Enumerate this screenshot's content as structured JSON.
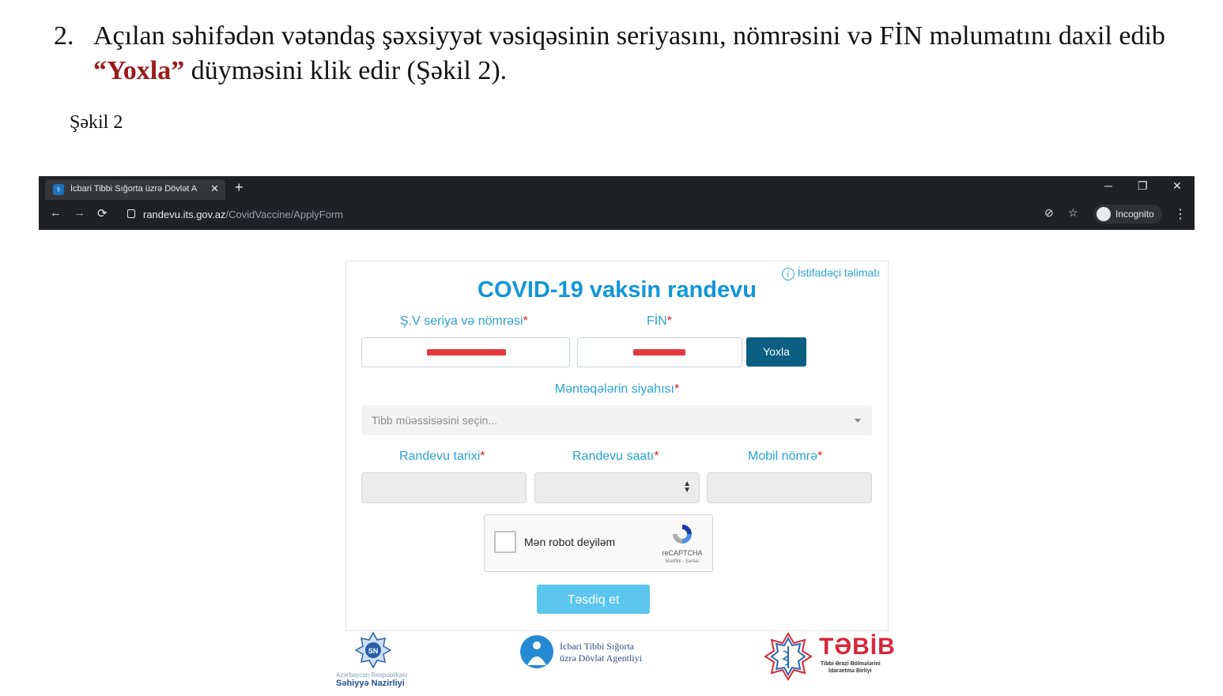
{
  "document": {
    "step_number": "2.",
    "step_before": "Açılan səhifədən vətəndaş şəxsiyyət vəsiqəsinin seriyasını, nömrəsini və FİN məlumatını daxil edib ",
    "step_highlight": "“Yoxla”",
    "step_after": " düyməsini klik edir (Şəkil 2).",
    "caption": "Şəkil 2"
  },
  "browser": {
    "tab_title": "İcbari Tibbi Sığorta üzrə Dövlət A",
    "url_host": "randevu.its.gov.az",
    "url_path": "/CovidVaccine/ApplyForm",
    "incognito_label": "Incognito",
    "new_tab_glyph": "+",
    "close_glyph": "✕"
  },
  "form": {
    "help_link": "İstifadəçi təlimatı",
    "title": "COVID-19 vaksin randevu",
    "id_label": "Ş.V seriya və nömrəsi",
    "fin_label": "FİN",
    "required_mark": "*",
    "check_button": "Yoxla",
    "centers_label": "Məntəqələrin siyahısı",
    "centers_placeholder": "Tibb müəssisəsini seçin...",
    "date_label": "Randevu tarixi",
    "time_label": "Randevu saatı",
    "phone_label": "Mobil nömrə",
    "recaptcha_label": "Mən robot deyiləm",
    "recaptcha_brand": "reCAPTCHA",
    "recaptcha_terms": "Məxfilik - Şərtlər",
    "submit_button": "Təsdiq et"
  },
  "footer": {
    "sn_badge": "SN",
    "sn_subtitle": "Azərbaycan Respublikası",
    "sn_name": "Səhiyyə Nazirliyi",
    "its_line1": "İcbari Tibbi Sığorta",
    "its_line2": "üzrə Dövlət Agentliyi",
    "tabib_name": "TƏBİB",
    "tabib_sub1": "Tibbi Ərazi Bölmələrini",
    "tabib_sub2": "İdarəetmə Birliyi"
  },
  "colors": {
    "title_blue": "#1196d8",
    "label_blue": "#2aa2d8",
    "check_button": "#0b5f82",
    "submit_button": "#5bc6ee",
    "highlight_red": "#9a1a1a"
  }
}
